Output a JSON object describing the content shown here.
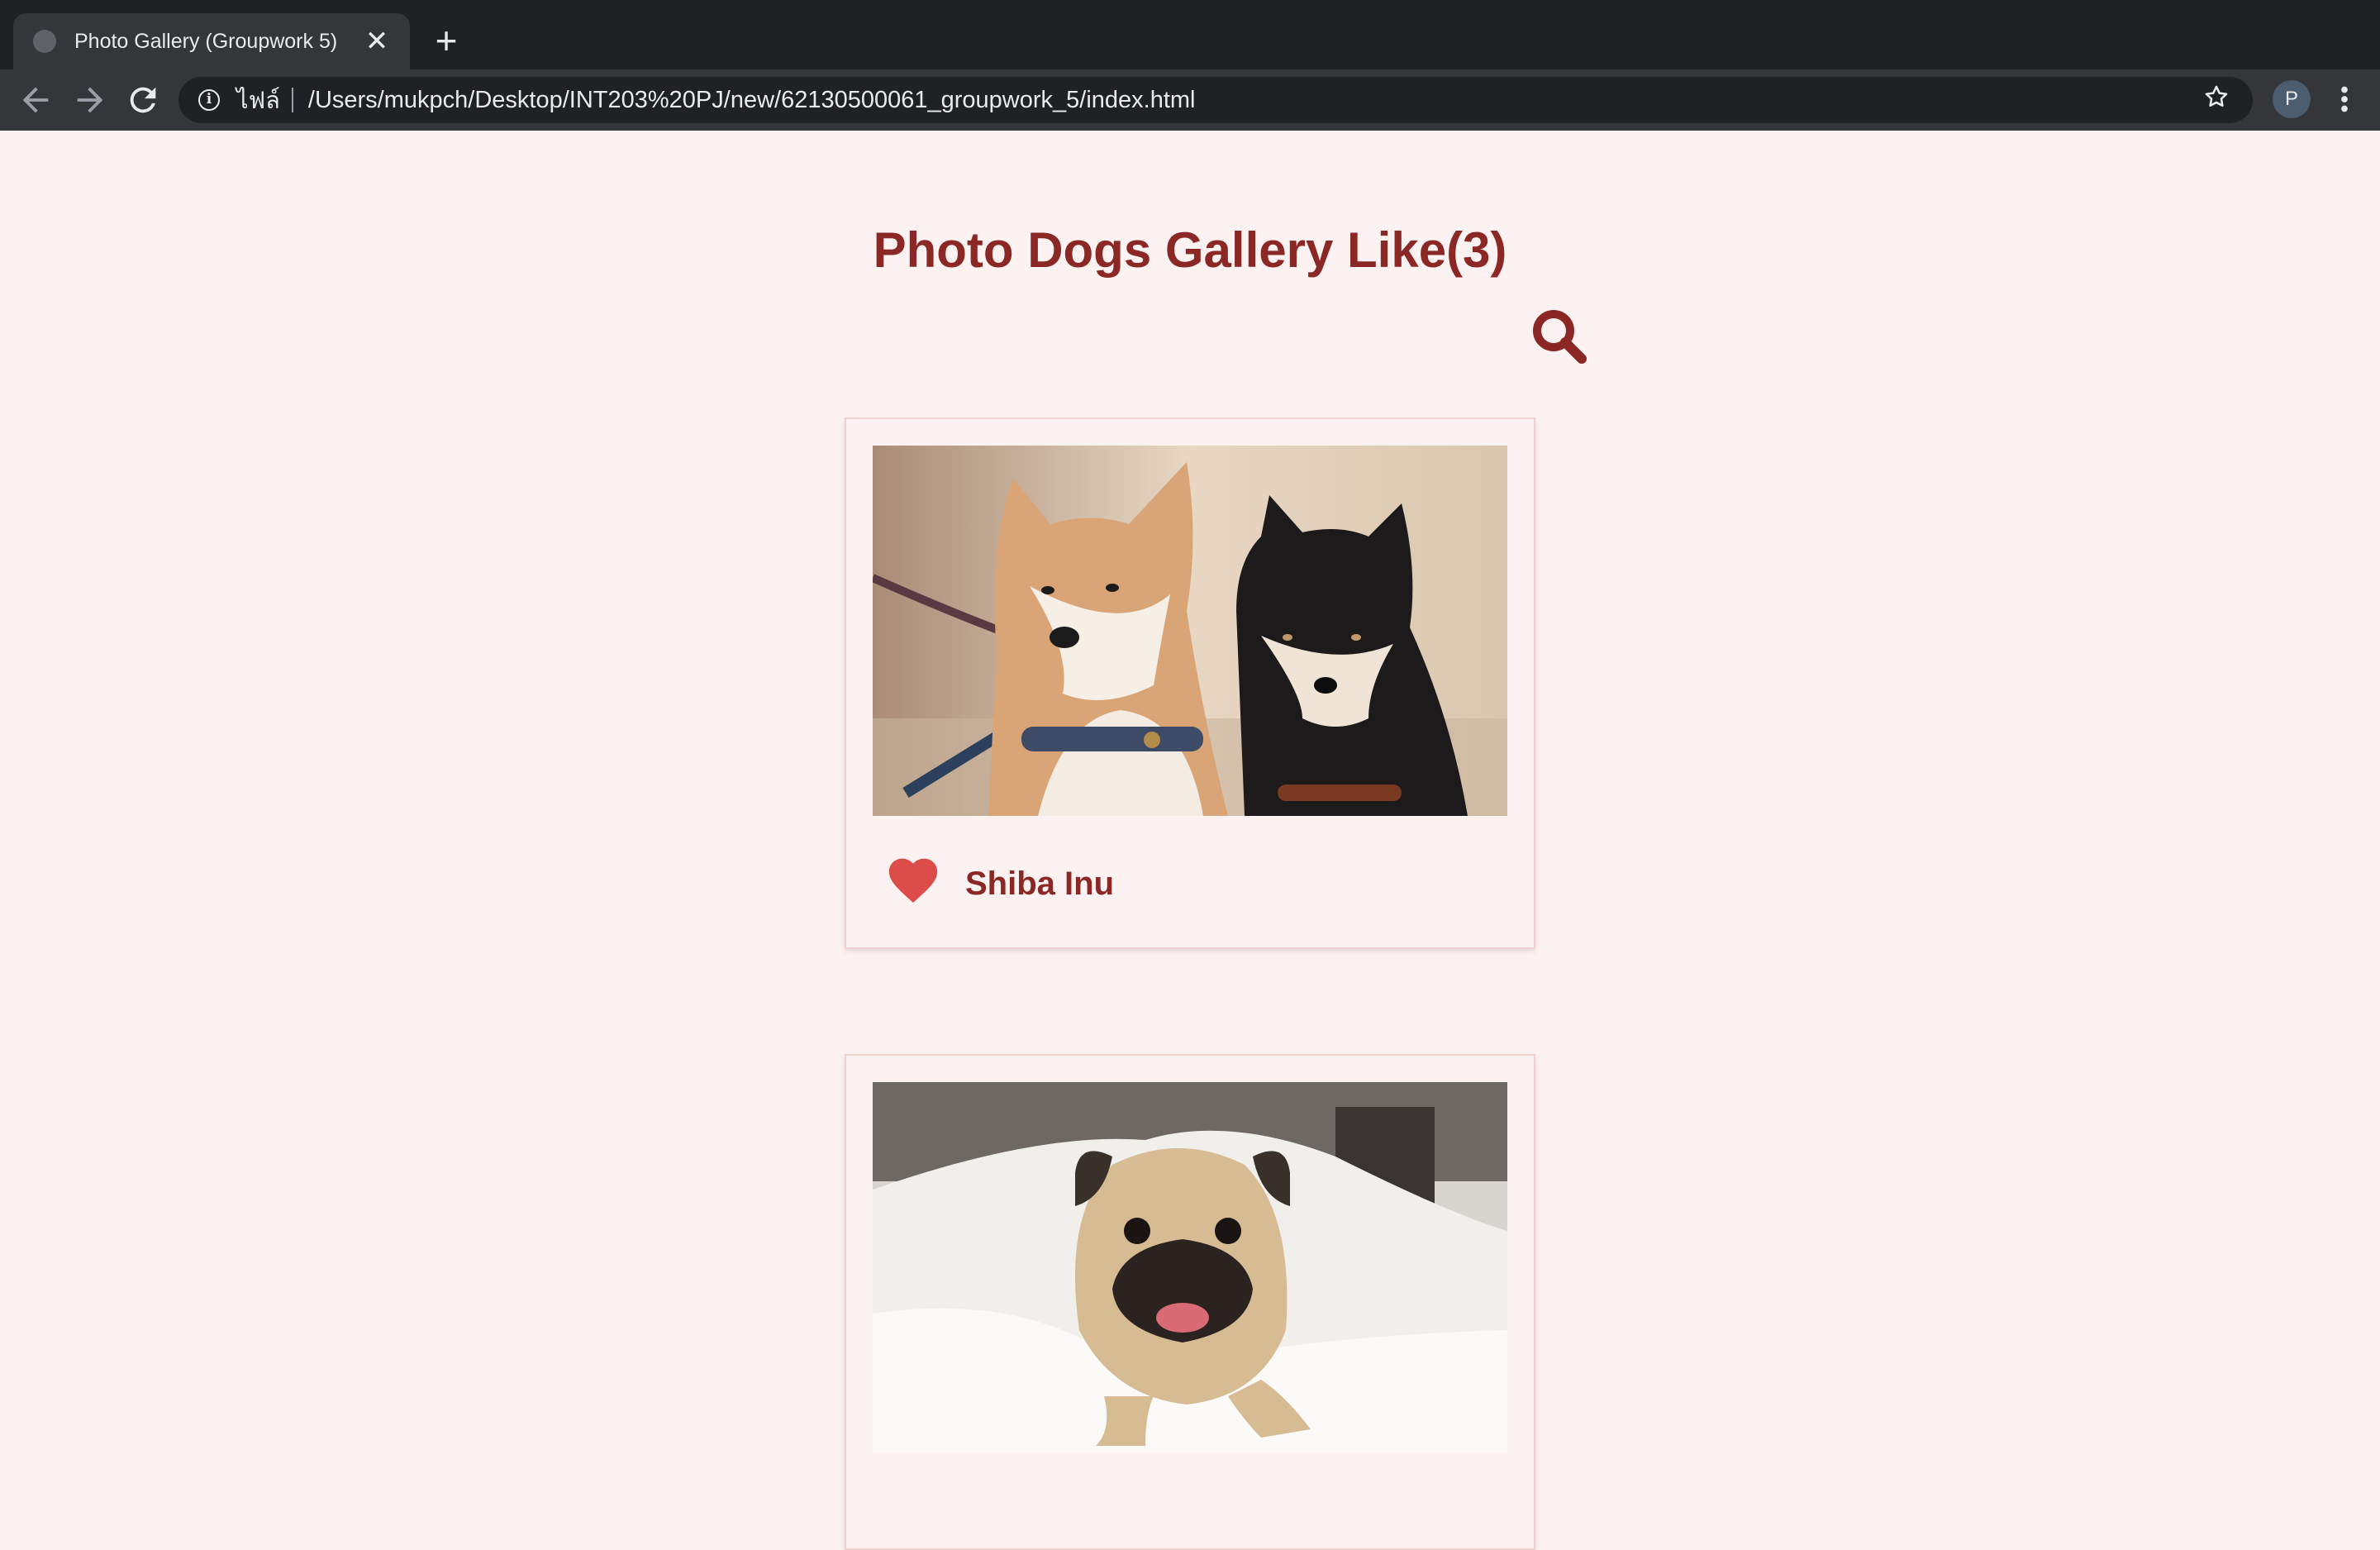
{
  "browser": {
    "tab_title": "Photo Gallery (Groupwork 5)",
    "tab_close": "✕",
    "new_tab": "+",
    "address": {
      "scheme_label": "ไฟล์",
      "url": "/Users/mukpch/Desktop/INT203%20PJ/new/62130500061_groupwork_5/index.html"
    },
    "profile_initial": "P"
  },
  "page": {
    "title": "Photo Dogs Gallery Like(3)",
    "accent_color": "#8b2724",
    "background_color": "#fdf2f2"
  },
  "gallery": [
    {
      "name": "Shiba Inu",
      "liked": true,
      "photo": "two shiba inu dogs, tan and black"
    },
    {
      "name": "",
      "liked": false,
      "photo": "pug under white blanket"
    }
  ]
}
